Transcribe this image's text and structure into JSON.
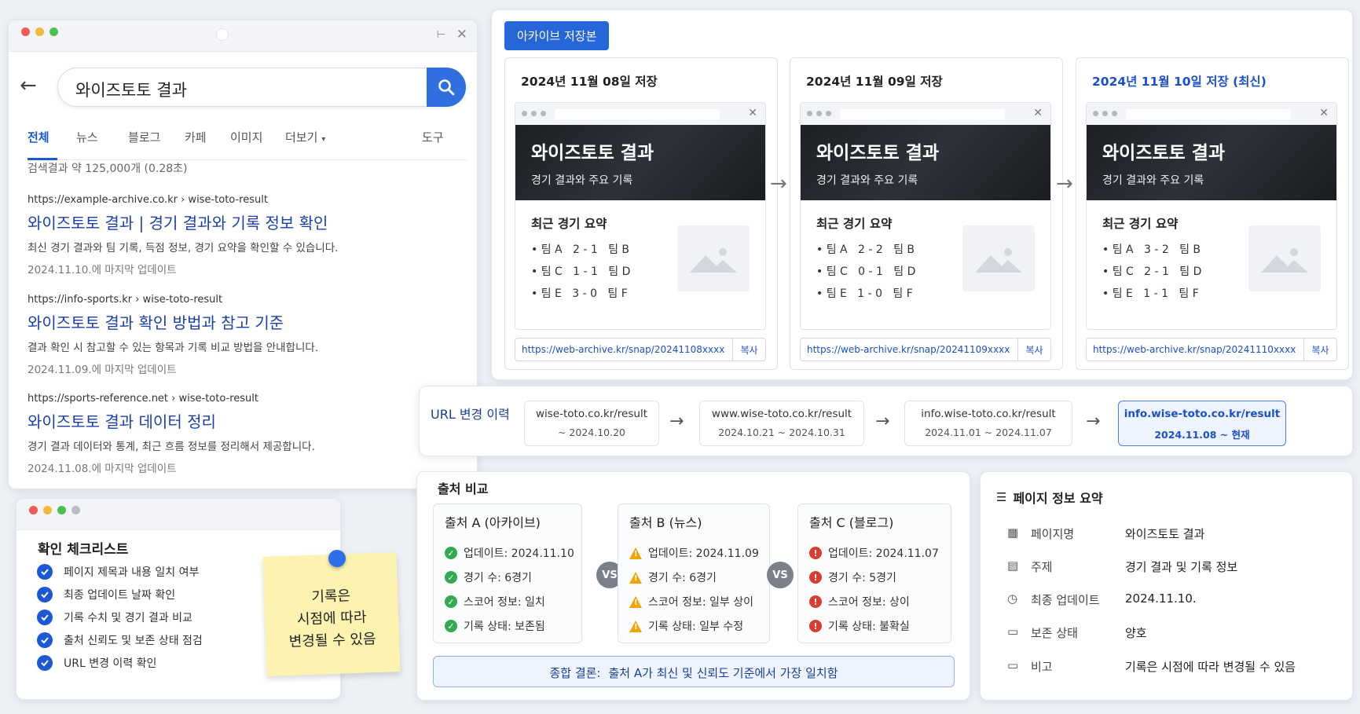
{
  "search": {
    "query": "와이즈토토 결과",
    "tabs": [
      "전체",
      "뉴스",
      "블로그",
      "카페",
      "이미지",
      "더보기"
    ],
    "tools_label": "도구",
    "result_count": "검색결과 약 125,000개 (0.28초)",
    "results": [
      {
        "url": "https://example-archive.co.kr › wise-toto-result",
        "title": "와이즈토토 결과 | 경기 결과와 기록 정보 확인",
        "desc": "최신 경기 결과와 팀 기록, 득점 정보, 경기 요약을 확인할 수 있습니다.",
        "date": "2024.11.10.에 마지막 업데이트"
      },
      {
        "url": "https://info-sports.kr › wise-toto-result",
        "title": "와이즈토토 결과 확인 방법과 참고 기준",
        "desc": "결과 확인 시 참고할 수 있는 항목과 기록 비교 방법을 안내합니다.",
        "date": "2024.11.09.에 마지막 업데이트"
      },
      {
        "url": "https://sports-reference.net › wise-toto-result",
        "title": "와이즈토토 결과 데이터 정리",
        "desc": "경기 결과 데이터와 통계, 최근 흐름 정보를 정리해서 제공합니다.",
        "date": "2024.11.08.에 마지막 업데이트"
      }
    ]
  },
  "checklist": {
    "title": "확인 체크리스트",
    "items": [
      "페이지 제목과 내용 일치 여부",
      "최종 업데이트 날짜 확인",
      "기록 수치 및 경기 결과 비교",
      "출처 신뢰도 및 보존 상태 점검",
      "URL 변경 이력 확인"
    ]
  },
  "sticky_note": {
    "lines": [
      "기록은",
      "시점에 따라",
      "변경될 수 있음"
    ]
  },
  "archive": {
    "badge": "아카이브 저장본",
    "snapshots": [
      {
        "date": "2024년 11월 08일 저장",
        "hero_title": "와이즈토토 결과",
        "hero_sub": "경기 결과와 주요 기록",
        "summary_title": "최근 경기 요약",
        "scores": [
          "팀 A   2 - 1   팀 B",
          "팀 C   1 - 1   팀 D",
          "팀 E   3 - 0   팀 F"
        ],
        "url": "https://web-archive.kr/snap/20241108xxxx",
        "copy": "복사"
      },
      {
        "date": "2024년 11월 09일 저장",
        "hero_title": "와이즈토토 결과",
        "hero_sub": "경기 결과와 주요 기록",
        "summary_title": "최근 경기 요약",
        "scores": [
          "팀 A   2 - 2   팀 B",
          "팀 C   0 - 1   팀 D",
          "팀 E   1 - 0   팀 F"
        ],
        "url": "https://web-archive.kr/snap/20241109xxxx",
        "copy": "복사"
      },
      {
        "date": "2024년 11월 10일 저장 (최신)",
        "hero_title": "와이즈토토 결과",
        "hero_sub": "경기 결과와 주요 기록",
        "summary_title": "최근 경기 요약",
        "scores": [
          "팀 A   3 - 2   팀 B",
          "팀 C   2 - 1   팀 D",
          "팀 E   1 - 1   팀 F"
        ],
        "url": "https://web-archive.kr/snap/20241110xxxx",
        "copy": "복사"
      }
    ]
  },
  "url_history": {
    "label": "URL 변경 이력",
    "entries": [
      {
        "host": "wise-toto.co.kr/result",
        "range": "~ 2024.10.20"
      },
      {
        "host": "www.wise-toto.co.kr/result",
        "range": "2024.10.21 ~ 2024.10.31"
      },
      {
        "host": "info.wise-toto.co.kr/result",
        "range": "2024.11.01 ~ 2024.11.07"
      },
      {
        "host": "info.wise-toto.co.kr/result",
        "range": "2024.11.08 ~ 현재"
      }
    ]
  },
  "source_compare": {
    "title": "출처 비교",
    "vs_label": "VS",
    "sources": [
      {
        "name": "출처 A (아카이브)",
        "status": "ok",
        "rows": [
          "업데이트: 2024.11.10",
          "경기 수: 6경기",
          "스코어 정보: 일치",
          "기록 상태: 보존됨"
        ]
      },
      {
        "name": "출처 B (뉴스)",
        "status": "warn",
        "rows": [
          "업데이트: 2024.11.09",
          "경기 수: 6경기",
          "스코어 정보: 일부 상이",
          "기록 상태: 일부 수정"
        ]
      },
      {
        "name": "출처 C (블로그)",
        "status": "bad",
        "rows": [
          "업데이트: 2024.11.07",
          "경기 수: 5경기",
          "스코어 정보: 상이",
          "기록 상태: 불확실"
        ]
      }
    ],
    "conclusion_label": "종합 결론:",
    "conclusion_text": "출처 A가 최신 및 신뢰도 기준에서 가장 일치함"
  },
  "page_info": {
    "title": "페이지 정보 요약",
    "rows": [
      {
        "label": "페이지명",
        "value": "와이즈토토 결과",
        "icon": "building-icon"
      },
      {
        "label": "주제",
        "value": "경기 결과 및 기록 정보",
        "icon": "calendar-icon"
      },
      {
        "label": "최종 업데이트",
        "value": "2024.11.10.",
        "icon": "clock-icon"
      },
      {
        "label": "보존 상태",
        "value": "양호",
        "icon": "document-icon"
      },
      {
        "label": "비고",
        "value": "기록은 시점에 따라 변경될 수 있음",
        "icon": "note-icon"
      }
    ]
  },
  "colors": {
    "accent": "#2566d9",
    "link": "#1a3fb0",
    "ok": "#34a853",
    "warn": "#f0a500",
    "bad": "#dc3b32"
  }
}
